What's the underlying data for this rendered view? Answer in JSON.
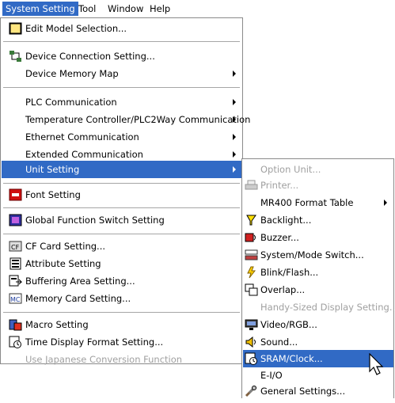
{
  "menubar": {
    "items": [
      {
        "label": "System Setting",
        "active": true
      },
      {
        "label": "Tool",
        "active": false
      },
      {
        "label": "Window",
        "active": false
      },
      {
        "label": "Help",
        "active": false
      }
    ]
  },
  "menu": {
    "items": [
      {
        "label": "Edit Model Selection...",
        "icon": "edit-model-icon",
        "disabled": false,
        "submenu": false
      },
      {
        "label": "Device Connection Setting...",
        "icon": "device-connection-icon",
        "disabled": false,
        "submenu": false
      },
      {
        "label": "Device Memory Map",
        "icon": "",
        "disabled": false,
        "submenu": true
      },
      {
        "label": "PLC Communication",
        "icon": "",
        "disabled": false,
        "submenu": true
      },
      {
        "label": "Temperature Controller/PLC2Way Communication",
        "icon": "",
        "disabled": false,
        "submenu": true
      },
      {
        "label": "Ethernet Communication",
        "icon": "",
        "disabled": false,
        "submenu": true
      },
      {
        "label": "Extended Communication",
        "icon": "",
        "disabled": false,
        "submenu": true
      },
      {
        "label": "Unit Setting",
        "icon": "",
        "disabled": false,
        "submenu": true,
        "highlighted": true
      },
      {
        "label": "Font Setting",
        "icon": "font-icon",
        "disabled": false,
        "submenu": false
      },
      {
        "label": "Global Function Switch Setting",
        "icon": "global-function-icon",
        "disabled": false,
        "submenu": false
      },
      {
        "label": "CF Card Setting...",
        "icon": "cf-card-icon",
        "disabled": false,
        "submenu": false
      },
      {
        "label": "Attribute Setting",
        "icon": "attribute-icon",
        "disabled": false,
        "submenu": false
      },
      {
        "label": "Buffering Area Setting...",
        "icon": "buffering-area-icon",
        "disabled": false,
        "submenu": false
      },
      {
        "label": "Memory Card Setting...",
        "icon": "memory-card-icon",
        "disabled": false,
        "submenu": false
      },
      {
        "label": "Macro Setting",
        "icon": "macro-icon",
        "disabled": false,
        "submenu": false
      },
      {
        "label": "Time Display Format Setting...",
        "icon": "time-display-icon",
        "disabled": false,
        "submenu": false
      },
      {
        "label": "Use Japanese Conversion Function",
        "icon": "",
        "disabled": true,
        "submenu": false
      }
    ]
  },
  "submenu": {
    "items": [
      {
        "label": "Option Unit...",
        "icon": "",
        "disabled": true,
        "submenu": false
      },
      {
        "label": "Printer...",
        "icon": "printer-icon",
        "disabled": true,
        "submenu": false
      },
      {
        "label": "MR400 Format Table",
        "icon": "",
        "disabled": false,
        "submenu": true
      },
      {
        "label": "Backlight...",
        "icon": "backlight-icon",
        "disabled": false,
        "submenu": false
      },
      {
        "label": "Buzzer...",
        "icon": "buzzer-icon",
        "disabled": false,
        "submenu": false
      },
      {
        "label": "System/Mode Switch...",
        "icon": "system-mode-switch-icon",
        "disabled": false,
        "submenu": false
      },
      {
        "label": "Blink/Flash...",
        "icon": "blink-flash-icon",
        "disabled": false,
        "submenu": false
      },
      {
        "label": "Overlap...",
        "icon": "overlap-icon",
        "disabled": false,
        "submenu": false
      },
      {
        "label": "Handy-Sized Display Setting...",
        "icon": "",
        "disabled": true,
        "submenu": false
      },
      {
        "label": "Video/RGB...",
        "icon": "video-rgb-icon",
        "disabled": false,
        "submenu": false
      },
      {
        "label": "Sound...",
        "icon": "sound-icon",
        "disabled": false,
        "submenu": false
      },
      {
        "label": "SRAM/Clock...",
        "icon": "sram-clock-icon",
        "disabled": false,
        "submenu": false,
        "highlighted": true
      },
      {
        "label": "E-I/O",
        "icon": "",
        "disabled": false,
        "submenu": true
      },
      {
        "label": "General Settings...",
        "icon": "general-settings-icon",
        "disabled": false,
        "submenu": false
      }
    ]
  },
  "colors": {
    "highlight": "#316ac5",
    "disabled_text": "#a0a0a0"
  }
}
